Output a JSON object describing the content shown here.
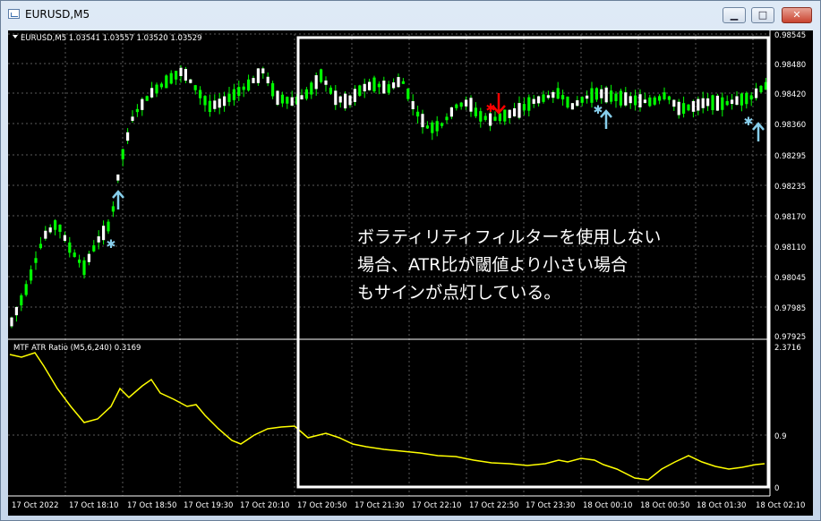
{
  "window": {
    "title": "EURUSD,M5",
    "minimize_glyph": "▁",
    "maximize_glyph": "□",
    "close_glyph": "✕"
  },
  "price_pane": {
    "header": "EURUSD,M5  1.03541 1.03557 1.03520 1.03529",
    "price_ticks": [
      "0.98545",
      "0.98480",
      "0.98420",
      "0.98360",
      "0.98295",
      "0.98235",
      "0.98170",
      "0.98110",
      "0.98045",
      "0.97985",
      "0.97925"
    ],
    "annotation_lines": [
      "ボラティリティフィルターを使用しない",
      "場合、ATR比が閾値より小さい場合",
      "もサインが点灯している。"
    ]
  },
  "indicator_pane": {
    "label": "MTF ATR Ratio  (M5,6,240) 0.3169",
    "scale_ticks": [
      "2.3716",
      "0.9",
      "0"
    ]
  },
  "time_axis": {
    "labels": [
      "17 Oct 2022",
      "17 Oct 18:10",
      "17 Oct 18:50",
      "17 Oct 19:30",
      "17 Oct 20:10",
      "17 Oct 20:50",
      "17 Oct 21:30",
      "17 Oct 22:10",
      "17 Oct 22:50",
      "17 Oct 23:30",
      "18 Oct 00:10",
      "18 Oct 00:50",
      "18 Oct 01:30",
      "18 Oct 02:10"
    ]
  },
  "colors": {
    "background": "#000000",
    "bull_candle": "#ffffff",
    "bear_candle": "#00ff00",
    "wick": "#00ff00",
    "atr_line": "#ffff00",
    "buy_signal": "#87ceeb",
    "sell_signal": "#ff0000",
    "highlight_box": "#ffffff",
    "axis_text": "#ffffff"
  },
  "icons": {
    "buy_arrow": "arrow-up-icon",
    "sell_arrow": "arrow-down-icon",
    "signal_star": "star-icon"
  }
}
